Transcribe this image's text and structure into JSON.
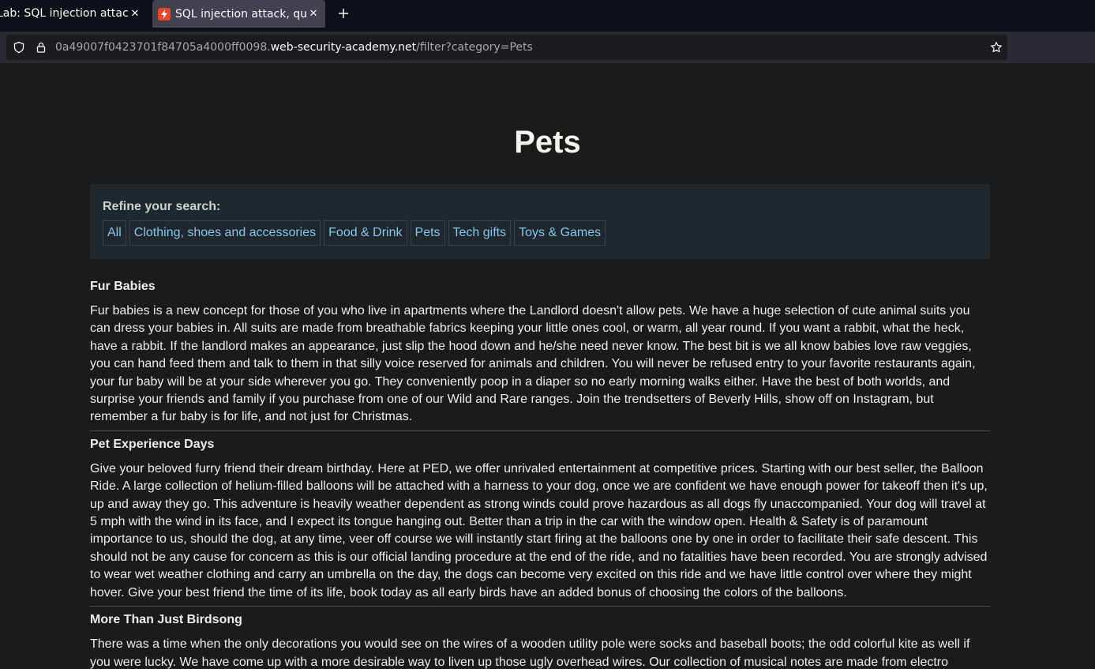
{
  "browser": {
    "tabs": [
      {
        "title": "Lab: SQL injection attack, querying the database type and version on Oracle"
      },
      {
        "title": "SQL injection attack, querying the database type and version on Oracle"
      }
    ],
    "url": {
      "prefix": "0a49007f0423701f84705a4000ff0098.",
      "host": "web-security-academy.net",
      "path": "/filter?category=Pets"
    }
  },
  "page": {
    "heading": "Pets",
    "filters": {
      "label": "Refine your search:",
      "links": [
        "All",
        "Clothing, shoes and accessories",
        "Food & Drink",
        "Pets",
        "Tech gifts",
        "Toys & Games"
      ]
    },
    "products": [
      {
        "title": "Fur Babies",
        "description": "Fur babies is a new concept for those of you who live in apartments where the Landlord doesn't allow pets. We have a huge selection of cute animal suits you can dress your babies in. All suits are made from breathable fabrics keeping your little ones cool, or warm, all year round. If you want a rabbit, what the heck, have a rabbit. If the landlord makes an appearance, just slip the hood down and he/she need never know. The best bit is we all know babies love raw veggies, you can hand feed them and talk to them in that silly voice reserved for animals and children. You will never be refused entry to your favorite restaurants again, your fur baby will be at your side wherever you go. They conveniently poop in a diaper so no early morning walks either. Have the best of both worlds, and surprise your friends and family if you purchase from one of our Wild and Rare ranges. Join the trendsetters of Beverly Hills, show off on Instagram, but remember a fur baby is for life, and not just for Christmas."
      },
      {
        "title": "Pet Experience Days",
        "description": "Give your beloved furry friend their dream birthday. Here at PED, we offer unrivaled entertainment at competitive prices. Starting with our best seller, the Balloon Ride. A large collection of helium-filled balloons will be attached with a harness to your dog, once we are confident we have enough power for takeoff then it's up, up and away they go. This adventure is heavily weather dependent as strong winds could prove hazardous as all dogs fly unaccompanied. Your dog will travel at 5 mph with the wind in its face, and I expect its tongue hanging out. Better than a trip in the car with the window open. Health & Safety is of paramount importance to us, should the dog, at any time, veer off course we will instantly start firing at the balloons one by one in order to facilitate their safe descent. This should not be any cause for concern as this is our official landing procedure at the end of the ride, and no fatalities have been recorded. You are strongly advised to wear wet weather clothing and carry an umbrella on the day, the dogs can become very excited on this ride and we have little control over where they might hover. Give your best friend the time of its life, book today as all early birds have an added bonus of choosing the colors of the balloons."
      },
      {
        "title": "More Than Just Birdsong",
        "description": "There was a time when the only decorations you would see on the wires of a wooden utility pole were socks and baseball boots; the odd colorful kite as well if you were lucky. We have come up with a more desirable way to liven up those ugly overhead wires. Our collection of musical notes are made from electro"
      }
    ]
  },
  "colors": {
    "accent_link": "#7fc7ee",
    "logo_blue": "#0e6a90",
    "page_bg": "#1c1b1c",
    "filter_bg": "#20282d"
  }
}
